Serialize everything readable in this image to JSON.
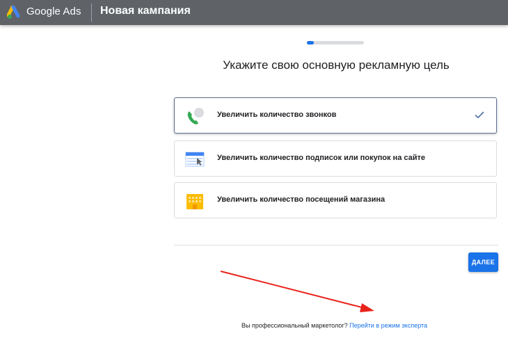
{
  "header": {
    "brand": "Google Ads",
    "campaign_title": "Новая кампания"
  },
  "progress": {
    "value_percent": 12
  },
  "page": {
    "heading": "Укажите свою основную рекламную цель"
  },
  "goals": [
    {
      "label": "Увеличить количество звонков",
      "icon": "phone-icon",
      "selected": true
    },
    {
      "label": "Увеличить количество подписок или покупок на сайте",
      "icon": "website-icon",
      "selected": false
    },
    {
      "label": "Увеличить количество посещений магазина",
      "icon": "store-icon",
      "selected": false
    }
  ],
  "actions": {
    "next_label": "ДАЛЕЕ"
  },
  "footer": {
    "question": "Вы профессиональный маркетолог?",
    "link": "Перейти в режим эксперта"
  },
  "colors": {
    "topbar": "#5f6368",
    "accent": "#1a73e8",
    "annotation_arrow": "#e8221a"
  }
}
